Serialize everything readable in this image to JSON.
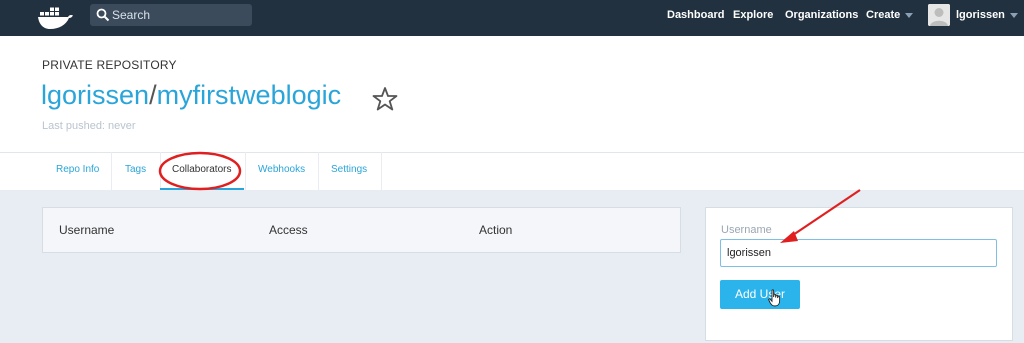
{
  "topbar": {
    "search_placeholder": "Search",
    "nav": {
      "dashboard": "Dashboard",
      "explore": "Explore",
      "organizations": "Organizations",
      "create": "Create",
      "user": "lgorissen"
    }
  },
  "repo": {
    "type": "PRIVATE REPOSITORY",
    "owner": "lgorissen",
    "slash": "/",
    "name": "myfirstweblogic",
    "last_pushed": "Last pushed: never"
  },
  "tabs": [
    "Repo Info",
    "Tags",
    "Collaborators",
    "Webhooks",
    "Settings"
  ],
  "active_tab": "Collaborators",
  "table": {
    "columns": [
      "Username",
      "Access",
      "Action"
    ]
  },
  "add_form": {
    "label": "Username",
    "value": "lgorissen",
    "button": "Add User"
  },
  "colors": {
    "navbar": "#22313f",
    "accent": "#2aa5d9",
    "button": "#2bb4ec",
    "annotation": "#e02020"
  }
}
